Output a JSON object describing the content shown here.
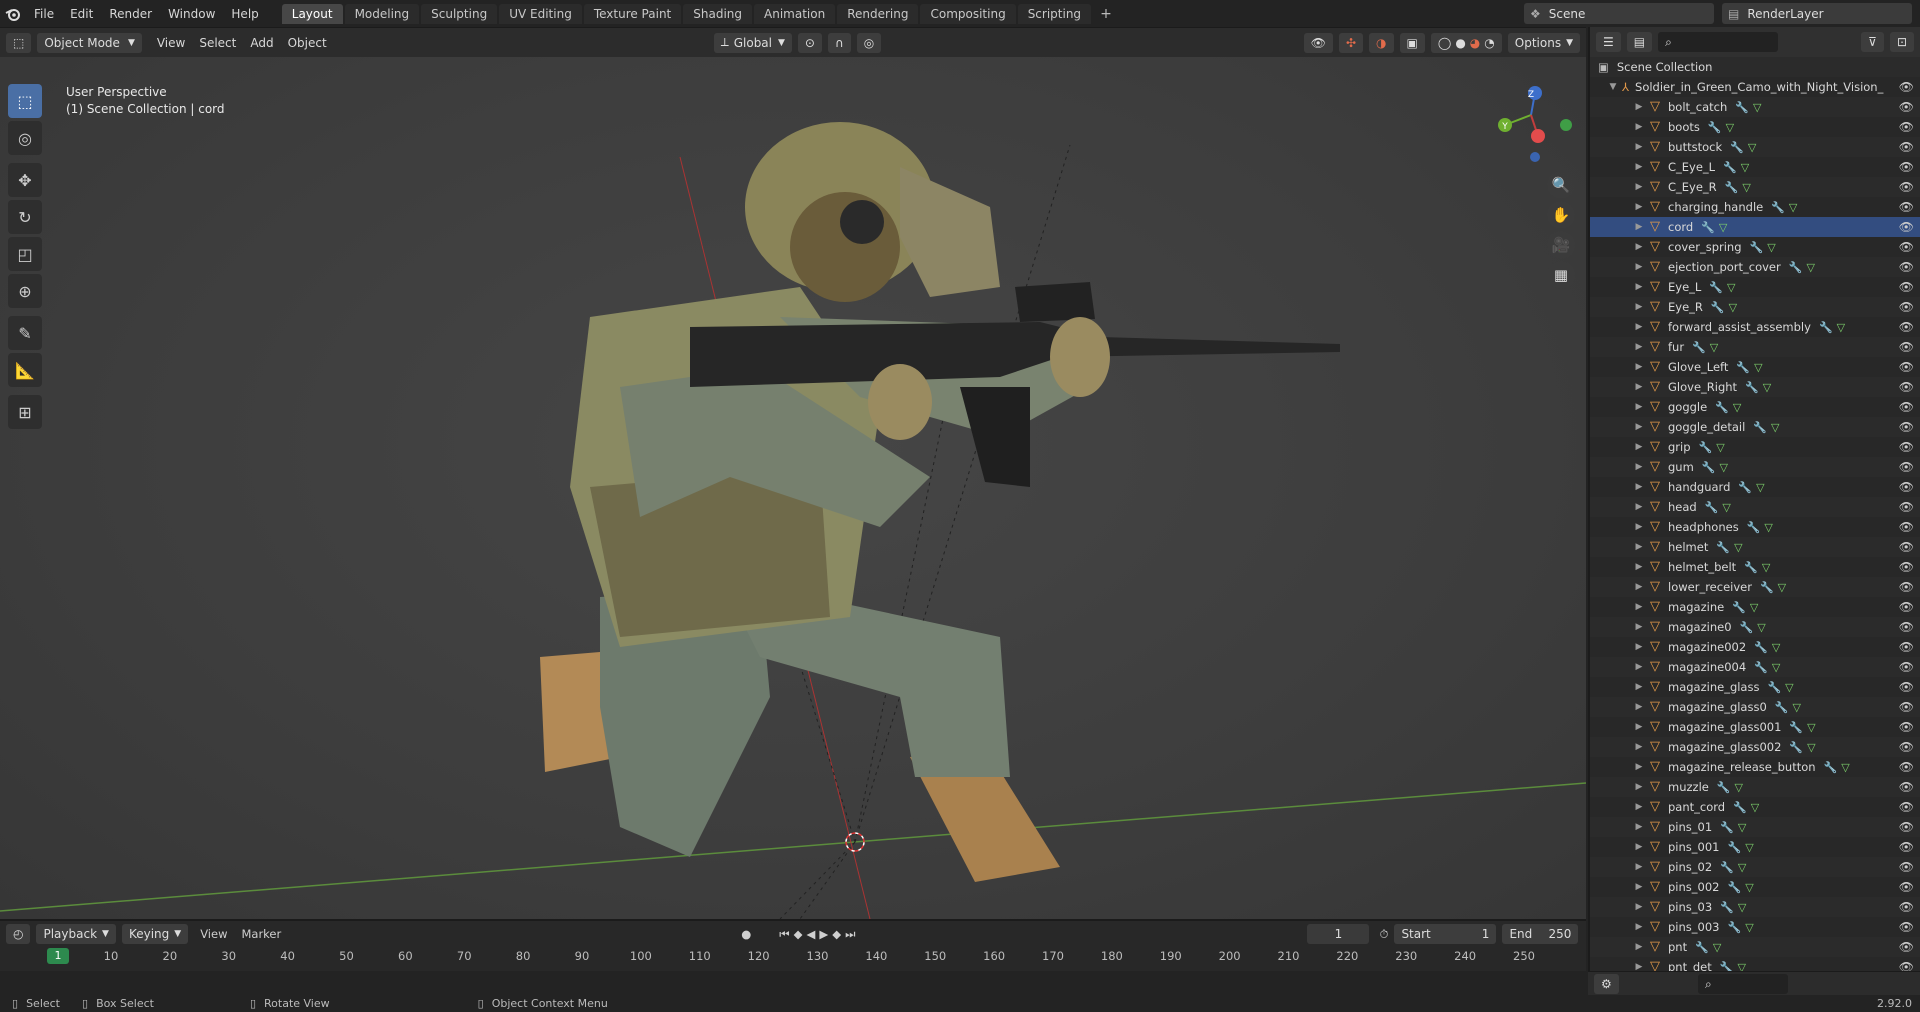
{
  "menu": {
    "file": "File",
    "edit": "Edit",
    "render": "Render",
    "window": "Window",
    "help": "Help"
  },
  "workspaces": [
    "Layout",
    "Modeling",
    "Sculpting",
    "UV Editing",
    "Texture Paint",
    "Shading",
    "Animation",
    "Rendering",
    "Compositing",
    "Scripting"
  ],
  "add_tab": "+",
  "scene": {
    "label": "Scene",
    "renderlayer": "RenderLayer"
  },
  "header3d": {
    "mode": "Object Mode",
    "view": "View",
    "select": "Select",
    "add": "Add",
    "object": "Object",
    "orientation": "Global",
    "options": "Options"
  },
  "viewport": {
    "perspective": "User Perspective",
    "collection": "(1) Scene Collection | cord"
  },
  "outliner": {
    "root": "Scene Collection",
    "parent": "Soldier_in_Green_Camo_with_Night_Vision_",
    "selected": "cord",
    "items": [
      "bolt_catch",
      "boots",
      "buttstock",
      "C_Eye_L",
      "C_Eye_R",
      "charging_handle",
      "cord",
      "cover_spring",
      "ejection_port_cover",
      "Eye_L",
      "Eye_R",
      "forward_assist_assembly",
      "fur",
      "Glove_Left",
      "Glove_Right",
      "goggle",
      "goggle_detail",
      "grip",
      "gum",
      "handguard",
      "head",
      "headphones",
      "helmet",
      "helmet_belt",
      "lower_receiver",
      "magazine",
      "magazine0",
      "magazine002",
      "magazine004",
      "magazine_glass",
      "magazine_glass0",
      "magazine_glass001",
      "magazine_glass002",
      "magazine_release_button",
      "muzzle",
      "pant_cord",
      "pins_01",
      "pins_001",
      "pins_02",
      "pins_002",
      "pins_03",
      "pins_003",
      "pnt",
      "pnt_det"
    ]
  },
  "timeline": {
    "playback": "Playback",
    "keying": "Keying",
    "view": "View",
    "marker": "Marker",
    "current_frame": "1",
    "start_label": "Start",
    "start": "1",
    "end_label": "End",
    "end": "250",
    "ticks": [
      "1",
      "10",
      "20",
      "30",
      "40",
      "50",
      "60",
      "70",
      "80",
      "90",
      "100",
      "110",
      "120",
      "130",
      "140",
      "150",
      "160",
      "170",
      "180",
      "190",
      "200",
      "210",
      "220",
      "230",
      "240",
      "250"
    ]
  },
  "status": {
    "select": "Select",
    "box_select": "Box Select",
    "rotate_view": "Rotate View",
    "context_menu": "Object Context Menu",
    "version": "2.92.0"
  }
}
